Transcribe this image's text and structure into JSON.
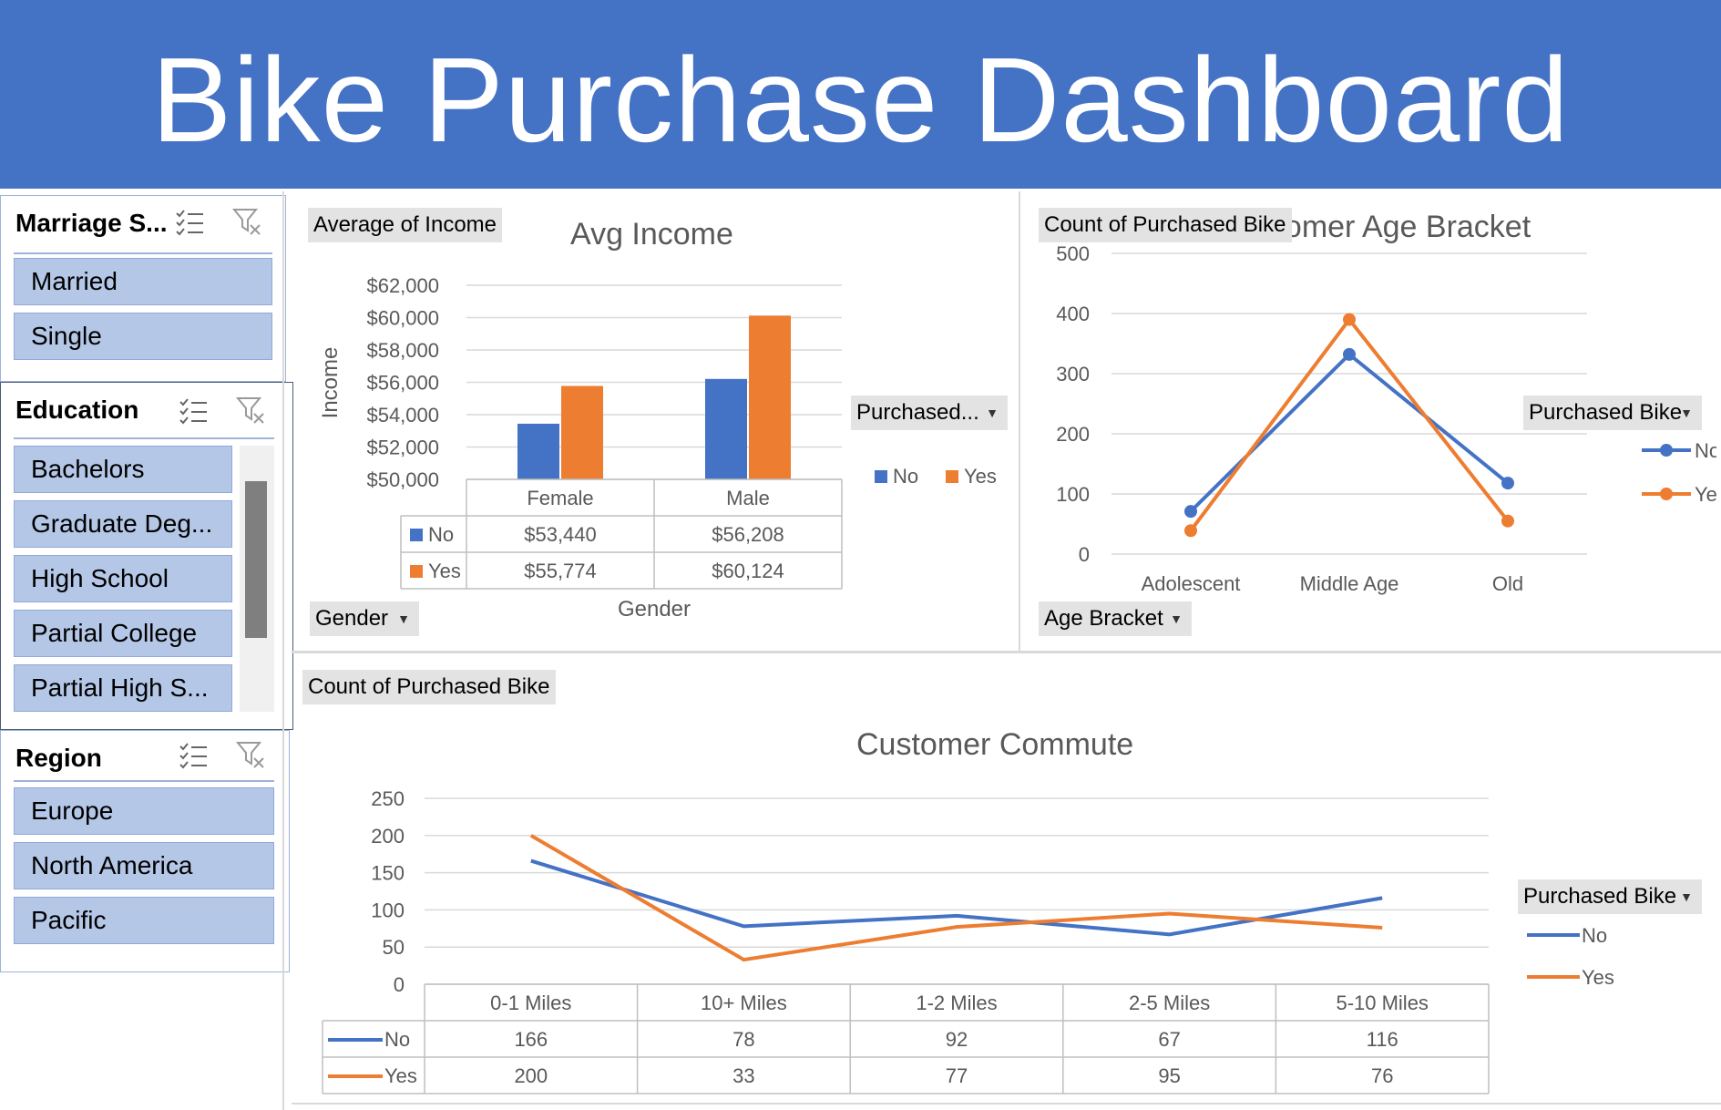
{
  "header": {
    "title": "Bike Purchase Dashboard"
  },
  "colors": {
    "no": "#4472C4",
    "yes": "#ED7D31",
    "header": "#4472C4",
    "slicer_item": "#B4C7E7"
  },
  "slicers": [
    {
      "title": "Marriage S...",
      "items": [
        "Married",
        "Single"
      ]
    },
    {
      "title": "Education",
      "items": [
        "Bachelors",
        "Graduate Deg...",
        "High School",
        "Partial College",
        "Partial High S..."
      ]
    },
    {
      "title": "Region",
      "items": [
        "Europe",
        "North America",
        "Pacific"
      ]
    }
  ],
  "income_chart": {
    "field_value": "Average of Income",
    "field_axis": "Gender",
    "legend_field": "Purchased...",
    "ylabel": "Income",
    "xlabel": "Gender"
  },
  "age_chart": {
    "field_value": "Count of Purchased Bike",
    "field_axis": "Age Bracket",
    "legend_field": "Purchased Bike"
  },
  "commute_chart": {
    "field_value": "Count of Purchased Bike",
    "legend_field": "Purchased Bike"
  },
  "chart_data": [
    {
      "type": "bar",
      "title": "Avg Income",
      "xlabel": "Gender",
      "ylabel": "Income",
      "categories": [
        "Female",
        "Male"
      ],
      "series": [
        {
          "name": "No",
          "values": [
            53440,
            56208
          ],
          "labels": [
            "$53,440",
            "$56,208"
          ]
        },
        {
          "name": "Yes",
          "values": [
            55774,
            60124
          ],
          "labels": [
            "$55,774",
            "$60,124"
          ]
        }
      ],
      "ylim": [
        50000,
        62000
      ],
      "yticks": [
        "$50,000",
        "$52,000",
        "$54,000",
        "$56,000",
        "$58,000",
        "$60,000",
        "$62,000"
      ],
      "legend": "right",
      "data_table": true
    },
    {
      "type": "line",
      "title": "Customer Age Bracket",
      "categories": [
        "Adolescent",
        "Middle Age",
        "Old"
      ],
      "series": [
        {
          "name": "No",
          "values": [
            71,
            332,
            118
          ]
        },
        {
          "name": "Yes",
          "values": [
            39,
            390,
            55
          ]
        }
      ],
      "ylim": [
        0,
        500
      ],
      "yticks": [
        "0",
        "100",
        "200",
        "300",
        "400",
        "500"
      ],
      "legend": "right"
    },
    {
      "type": "line",
      "title": "Customer Commute",
      "categories": [
        "0-1 Miles",
        "10+ Miles",
        "1-2 Miles",
        "2-5 Miles",
        "5-10 Miles"
      ],
      "series": [
        {
          "name": "No",
          "values": [
            166,
            78,
            92,
            67,
            116
          ]
        },
        {
          "name": "Yes",
          "values": [
            200,
            33,
            77,
            95,
            76
          ]
        }
      ],
      "ylim": [
        0,
        250
      ],
      "yticks": [
        "0",
        "50",
        "100",
        "150",
        "200",
        "250"
      ],
      "legend": "right",
      "data_table": true
    }
  ]
}
